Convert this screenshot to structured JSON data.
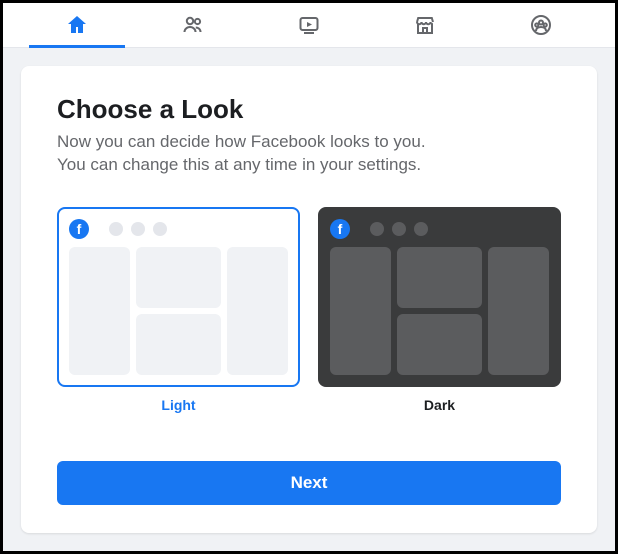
{
  "nav": {
    "items": [
      {
        "name": "home",
        "active": true
      },
      {
        "name": "friends",
        "active": false
      },
      {
        "name": "watch",
        "active": false
      },
      {
        "name": "marketplace",
        "active": false
      },
      {
        "name": "groups",
        "active": false
      }
    ]
  },
  "card": {
    "title": "Choose a Look",
    "subtitle_line1": "Now you can decide how Facebook looks to you.",
    "subtitle_line2": "You can change this at any time in your settings."
  },
  "options": {
    "light": {
      "label": "Light",
      "selected": true
    },
    "dark": {
      "label": "Dark",
      "selected": false
    }
  },
  "buttons": {
    "next": "Next"
  },
  "icons": {
    "fb_letter": "f"
  },
  "colors": {
    "accent": "#1877f2",
    "muted": "#65676b"
  }
}
